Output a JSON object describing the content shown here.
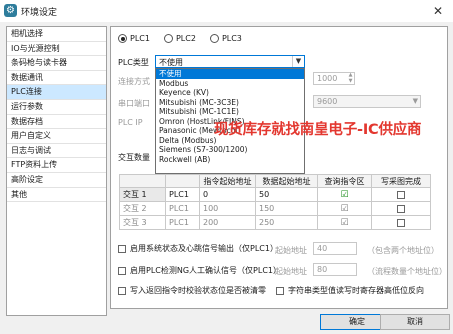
{
  "window": {
    "title": "环境设定",
    "close_glyph": "✕"
  },
  "sidebar": {
    "items": [
      "相机选择",
      "IO与光源控制",
      "条码枪与读卡器",
      "数据通讯",
      "PLC连接",
      "运行参数",
      "数据存档",
      "用户自定义",
      "日志与调试",
      "FTP资料上传",
      "高阶设定",
      "其他"
    ],
    "selected_index": 4
  },
  "plc_tabs": [
    {
      "label": "PLC1",
      "checked": true
    },
    {
      "label": "PLC2",
      "checked": false
    },
    {
      "label": "PLC3",
      "checked": false
    }
  ],
  "form": {
    "plc_type_label": "PLC类型",
    "plc_type_value": "不使用",
    "connect_mode_label": "连接方式",
    "com_port_label": "串口端口",
    "plc_ip_label": "PLC IP",
    "port_value": "1000",
    "baud_value": "9600",
    "interaction_count_label": "交互数量"
  },
  "plc_type_options": [
    "不使用",
    "Modbus",
    "Keyence (KV)",
    "Mitsubishi (MC-3C3E)",
    "Mitsubishi (MC-1C1E)",
    "Omron (HostLink/FINS)",
    "Panasonic (Mewtocol)",
    "Delta (Modbus)",
    "Siemens (S7-300/1200)",
    "Rockwell (AB)"
  ],
  "watermark": "现货库存就找南皇电子-IC供应商",
  "table": {
    "headers": [
      "",
      "",
      "指令起始地址",
      "数据起始地址",
      "查询指令区",
      "写采图完成"
    ],
    "rows": [
      {
        "name": "交互 1",
        "plc": "PLC1",
        "cmd_addr": "0",
        "data_addr": "50",
        "query": true,
        "write": false
      },
      {
        "name": "交互 2",
        "plc": "PLC1",
        "cmd_addr": "100",
        "data_addr": "150",
        "query": true,
        "write": false
      },
      {
        "name": "交互 3",
        "plc": "PLC1",
        "cmd_addr": "200",
        "data_addr": "250",
        "query": true,
        "write": false
      }
    ]
  },
  "options": {
    "sys_status": {
      "label": "启用系统状态及心跳信号输出（仅PLC1）",
      "addr_label": "起始地址",
      "addr_value": "40",
      "note": "（包含两个地址位）"
    },
    "ng_confirm": {
      "label": "启用PLC检测NG人工确认信号（仅PLC1）",
      "addr_label": "起始地址",
      "addr_value": "80",
      "note": "（流程数量个地址位）"
    },
    "write_back": {
      "label": "写入返回指令时校验状态位是否被清零"
    },
    "string_swap": {
      "label": "字符串类型值读写时寄存器高低位反向"
    }
  },
  "buttons": {
    "ok": "确定",
    "cancel": "取消"
  }
}
